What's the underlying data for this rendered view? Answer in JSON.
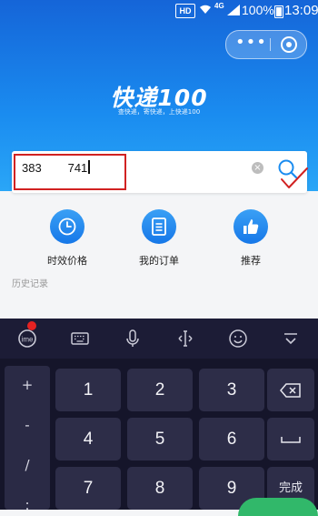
{
  "status_bar": {
    "hd": "HD",
    "network": "4G",
    "battery": "100%",
    "time": "13:09"
  },
  "capsule": {
    "more_icon": "more-dots-icon",
    "close_icon": "target-close-icon"
  },
  "header": {
    "logo": "快递100",
    "slogan": "查快递，寄快递，上快递100"
  },
  "search": {
    "value": "383        741",
    "clear_icon": "clear-x-icon",
    "search_icon": "search-icon"
  },
  "actions": [
    {
      "label": "时效价格",
      "icon": "clock-icon"
    },
    {
      "label": "我的订单",
      "icon": "document-icon"
    },
    {
      "label": "推荐",
      "icon": "thumbs-up-icon"
    }
  ],
  "history_label": "历史记录",
  "keyboard": {
    "toolbar_icons": [
      "ime-logo-icon",
      "keyboard-icon",
      "microphone-icon",
      "cursor-move-icon",
      "emoji-icon",
      "collapse-keyboard-icon"
    ],
    "side_keys": [
      "+",
      "-",
      "/",
      ":"
    ],
    "keys": [
      "1",
      "2",
      "3",
      "4",
      "5",
      "6",
      "7",
      "8",
      "9"
    ],
    "backspace_icon": "backspace-icon",
    "space_icon": "space-icon",
    "done_label": "完成"
  },
  "colors": {
    "brand_blue": "#1a8cf0",
    "highlight_red": "#d12222",
    "keyboard_bg": "#15152a"
  }
}
